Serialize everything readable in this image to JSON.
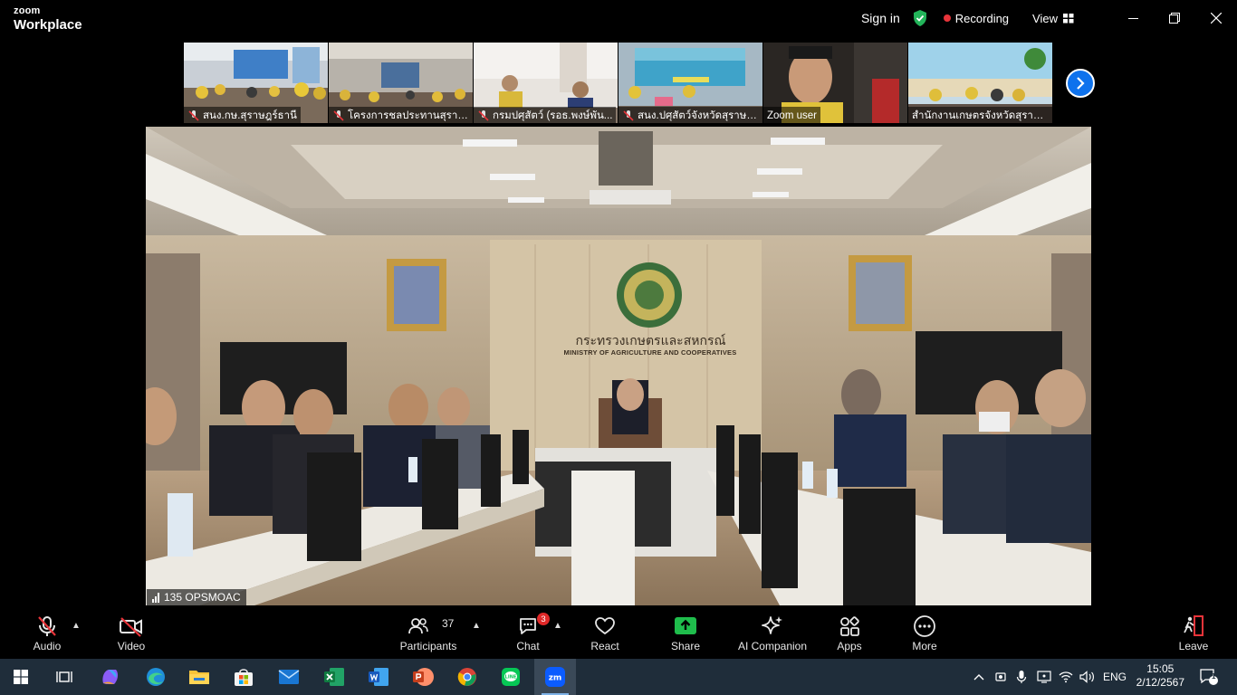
{
  "app": {
    "brand_top": "zoom",
    "brand_bottom": "Workplace"
  },
  "titlebar": {
    "sign_in": "Sign in",
    "recording": "Recording",
    "view": "View"
  },
  "participants_strip": [
    {
      "name": "สนง.กษ.สุราษฎร์ธานี",
      "muted": true
    },
    {
      "name": "โครงการชลประทานสุราษ...",
      "muted": true
    },
    {
      "name": "กรมปศุสัตว์ (รอธ.พงษ์พัน...",
      "muted": true
    },
    {
      "name": "สนง.ปศุสัตว์จังหวัดสุราษฎ...",
      "muted": true
    },
    {
      "name": "Zoom user",
      "muted": false
    },
    {
      "name": "สำนักงานเกษตรจังหวัดสุราษ...",
      "muted": false
    }
  ],
  "main_video": {
    "speaker_label": "135 OPSMOAC",
    "sign_thai": "กระทรวงเกษตรและสหกรณ์",
    "sign_english": "MINISTRY OF AGRICULTURE AND COOPERATIVES"
  },
  "toolbar": {
    "audio": "Audio",
    "video": "Video",
    "participants": "Participants",
    "participants_count": "37",
    "chat": "Chat",
    "chat_badge": "3",
    "react": "React",
    "share": "Share",
    "ai_companion": "AI Companion",
    "apps": "Apps",
    "more": "More",
    "leave": "Leave"
  },
  "taskbar": {
    "apps": [
      "start",
      "task-view",
      "copilot",
      "edge",
      "file-explorer",
      "microsoft-store",
      "mail",
      "excel",
      "word",
      "powerpoint",
      "chrome",
      "line",
      "zoom"
    ],
    "active_app": "zoom",
    "language": "ENG",
    "time": "15:05",
    "date": "2/12/2567",
    "notifications": "1"
  },
  "colors": {
    "accent": "#0e72ed",
    "share_green": "#1fbd4c",
    "recording_red": "#e8343a",
    "shield_green": "#23b45a"
  }
}
